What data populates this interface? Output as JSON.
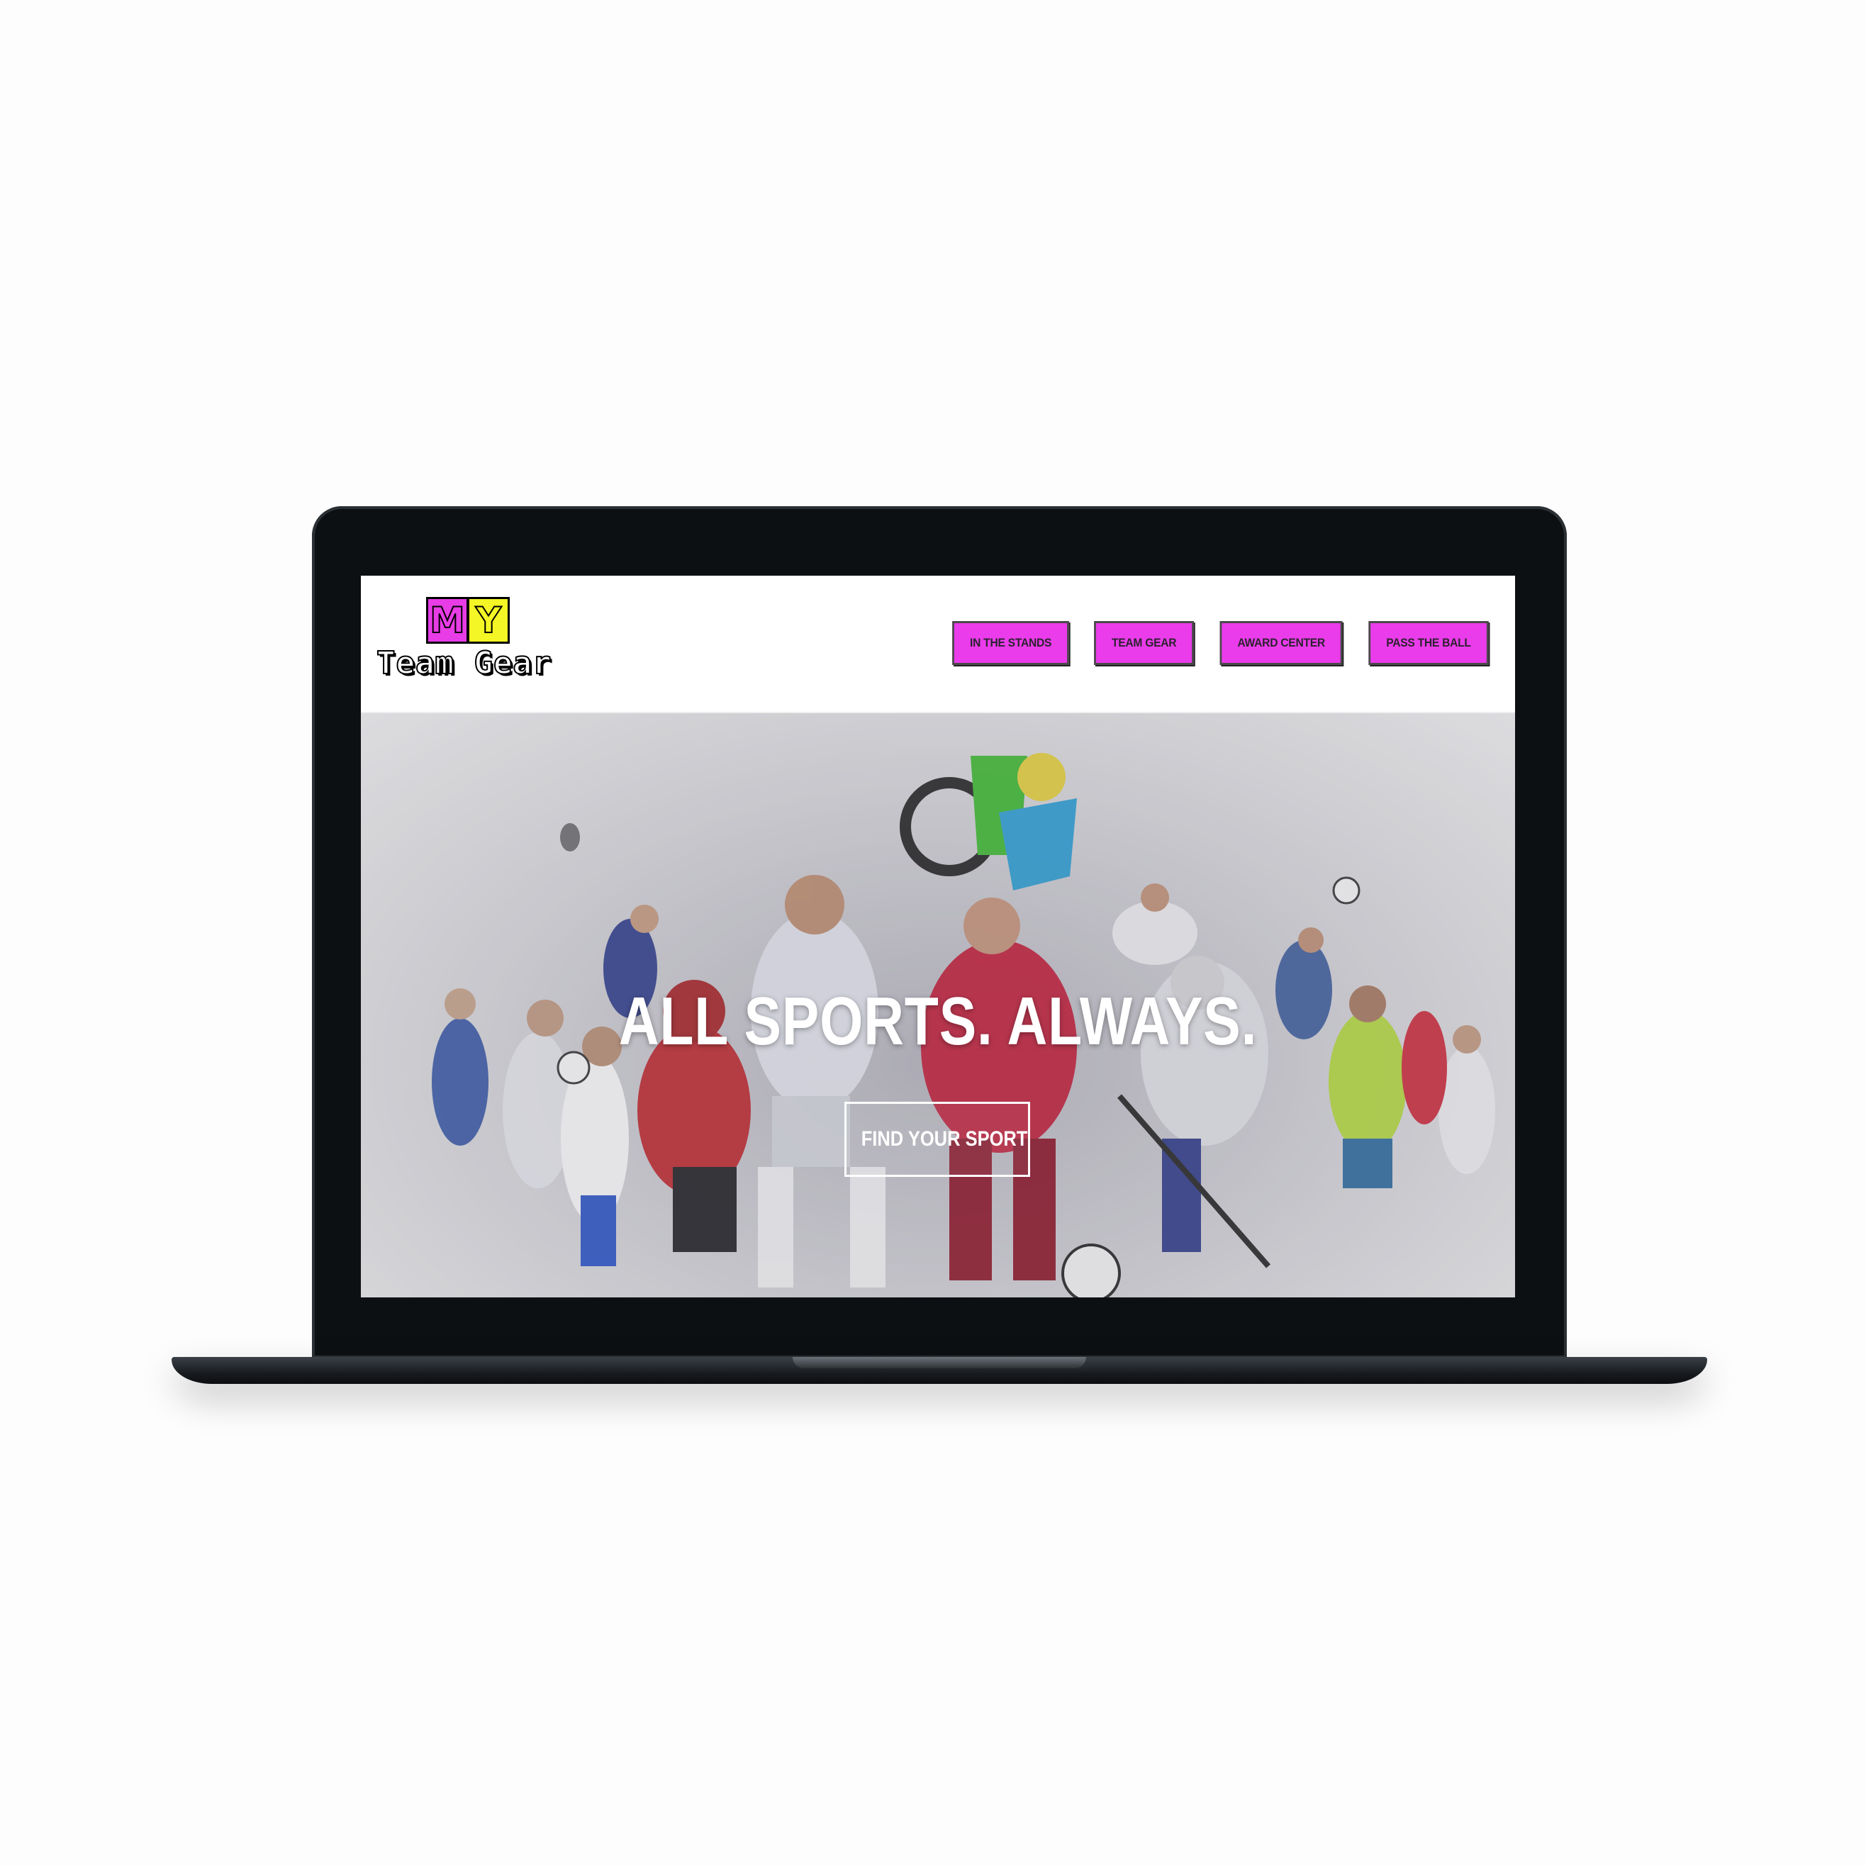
{
  "brand": {
    "logo_letter_1": "M",
    "logo_letter_2": "Y",
    "logo_text": "Team Gear",
    "colors": {
      "magenta": "#e83ce6",
      "yellow": "#f4f625"
    }
  },
  "nav": {
    "items": [
      {
        "label": "IN THE STANDS"
      },
      {
        "label": "TEAM GEAR"
      },
      {
        "label": "AWARD CENTER"
      },
      {
        "label": "PASS THE BALL"
      }
    ]
  },
  "hero": {
    "title": "ALL SPORTS. ALWAYS.",
    "cta_label": "FIND YOUR SPORT",
    "image_icon": "athletes-collage-image"
  }
}
